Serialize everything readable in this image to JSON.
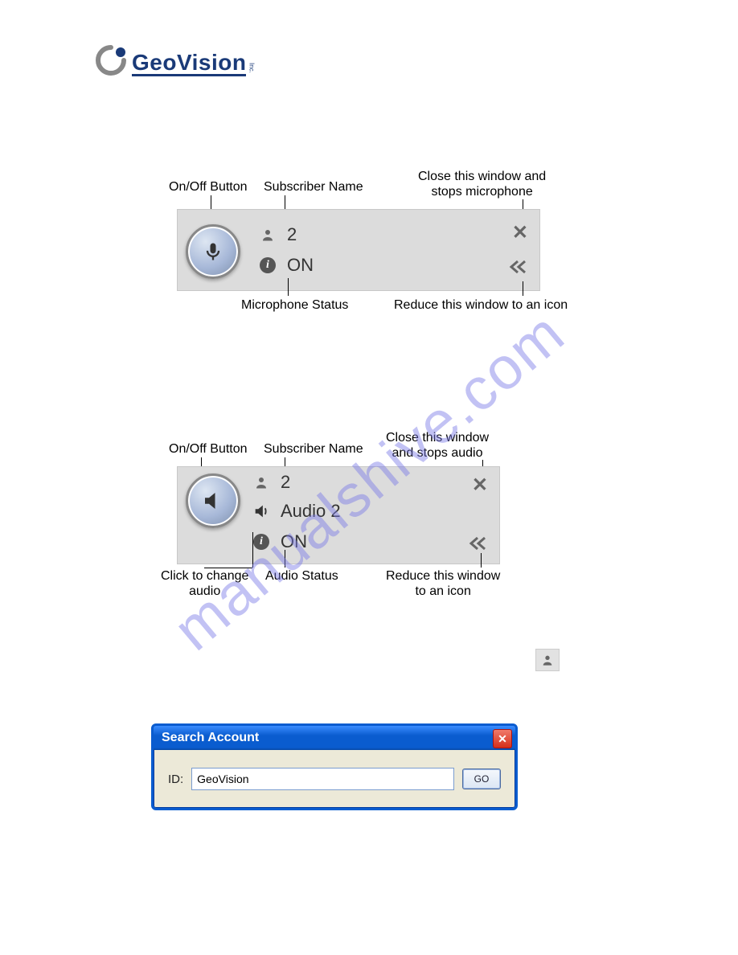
{
  "logo": {
    "brand": "GeoVision",
    "suffix": "Inc."
  },
  "watermark": "manualshive.com",
  "annotations": {
    "mic": {
      "onoff": "On/Off Button",
      "subscriber": "Subscriber Name",
      "close": "Close this window and\nstops microphone",
      "status": "Microphone Status",
      "minimize": "Reduce this window to an icon"
    },
    "audio": {
      "onoff": "On/Off Button",
      "subscriber": "Subscriber Name",
      "close": "Close this window\nand stops audio",
      "change": "Click to change\naudio",
      "status": "Audio Status",
      "minimize": "Reduce this window\nto an icon"
    }
  },
  "mic_panel": {
    "subscriber_value": "2",
    "status_value": "ON"
  },
  "audio_panel": {
    "subscriber_value": "2",
    "channel_label": "Audio 2",
    "status_value": "ON"
  },
  "search_window": {
    "title": "Search Account",
    "id_label": "ID:",
    "id_value": "GeoVision",
    "go_label": "GO"
  }
}
